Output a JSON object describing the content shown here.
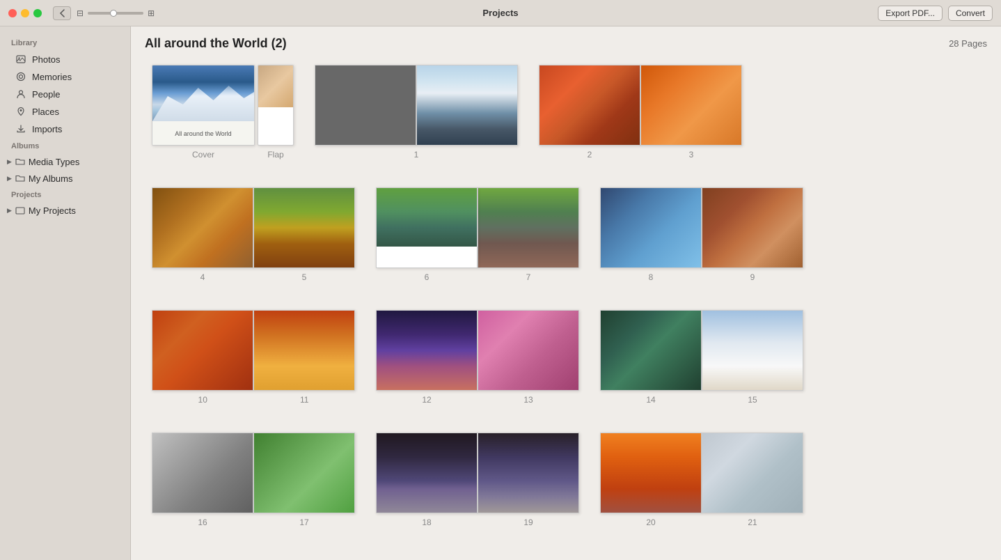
{
  "titlebar": {
    "title": "Projects",
    "export_label": "Export PDF...",
    "convert_label": "Convert"
  },
  "sidebar": {
    "library_label": "Library",
    "albums_label": "Albums",
    "projects_label": "Projects",
    "items": [
      {
        "id": "photos",
        "label": "Photos",
        "icon": "🖼"
      },
      {
        "id": "memories",
        "label": "Memories",
        "icon": "⭕"
      },
      {
        "id": "people",
        "label": "People",
        "icon": "👤"
      },
      {
        "id": "places",
        "label": "Places",
        "icon": "📍"
      },
      {
        "id": "imports",
        "label": "Imports",
        "icon": "⬇"
      }
    ],
    "albums_groups": [
      {
        "id": "media-types",
        "label": "Media Types"
      },
      {
        "id": "my-albums",
        "label": "My Albums"
      }
    ],
    "projects_groups": [
      {
        "id": "my-projects",
        "label": "My Projects"
      }
    ]
  },
  "content": {
    "title": "All around the World (2)",
    "page_count": "28 Pages",
    "pages": [
      {
        "label": "Cover",
        "type": "cover"
      },
      {
        "label": "Flap",
        "type": "flap"
      },
      {
        "number": "1",
        "type": "spread-grey"
      },
      {
        "number": "2",
        "type": "single-canyon"
      },
      {
        "number": "3",
        "type": "single-flowers"
      },
      {
        "number": "4",
        "type": "single-forest"
      },
      {
        "number": "5",
        "type": "single-autumn"
      },
      {
        "number": "6",
        "type": "single-valley"
      },
      {
        "number": "7",
        "type": "single-houses"
      },
      {
        "number": "8",
        "type": "single-arch"
      },
      {
        "number": "9",
        "type": "single-wood"
      },
      {
        "number": "10",
        "type": "single-canyon2"
      },
      {
        "number": "11",
        "type": "single-taxi"
      },
      {
        "number": "12",
        "type": "single-boats"
      },
      {
        "number": "13",
        "type": "single-cherry"
      },
      {
        "number": "14",
        "type": "single-geo"
      },
      {
        "number": "15",
        "type": "single-white"
      },
      {
        "number": "16",
        "type": "single-street"
      },
      {
        "number": "17",
        "type": "single-vines"
      },
      {
        "number": "18",
        "type": "single-bridge"
      },
      {
        "number": "19",
        "type": "single-city2"
      },
      {
        "number": "20",
        "type": "single-sunset"
      }
    ]
  }
}
